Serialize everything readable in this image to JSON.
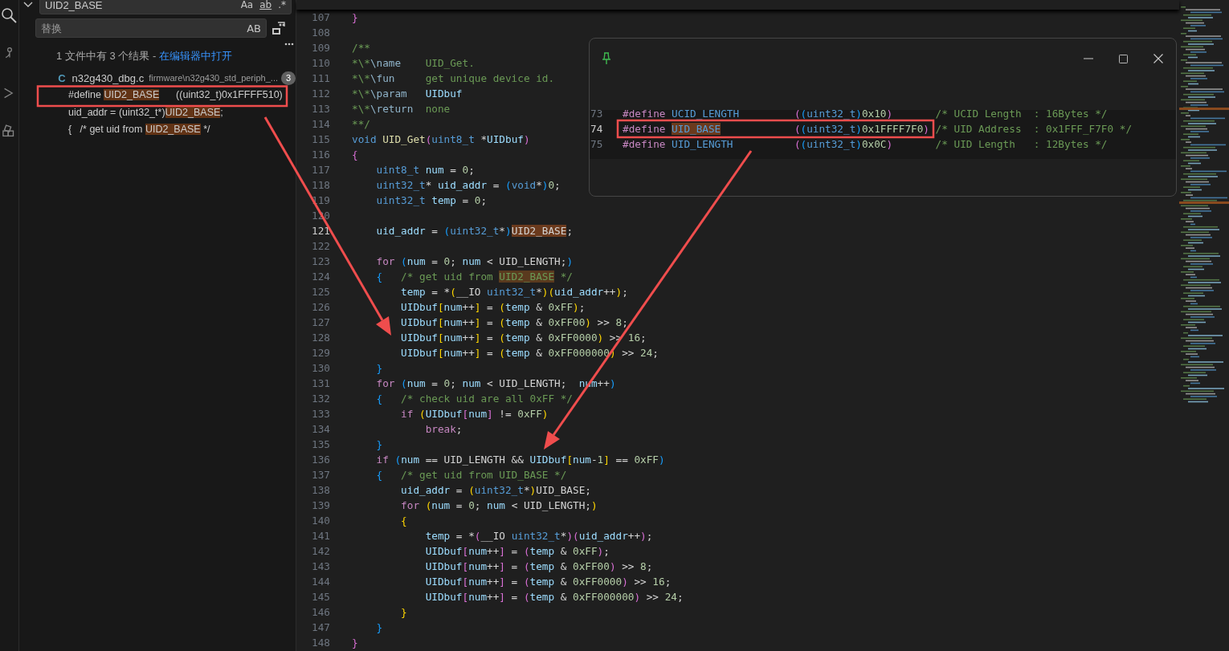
{
  "search": {
    "value": "UID2_BASE",
    "options": [
      "Aa",
      "ab",
      ".*"
    ],
    "replace_placeholder": "替换",
    "preserve_case": "AB"
  },
  "results": {
    "summary": "1 文件中有 3 个结果 - ",
    "open_link": "在编辑器中打开",
    "file": {
      "type_letter": "C",
      "name": "n32g430_dbg.c",
      "path": "firmware\\n32g430_std_periph_...",
      "count": "3"
    },
    "items": [
      {
        "before": "#define ",
        "match": "UID2_BASE",
        "after": "      ((uint32_t)0x1FFFF510)"
      },
      {
        "before": "uid_addr = (uint32_t*)",
        "match": "UID2_BASE",
        "after": ";"
      },
      {
        "before": "{   /* get uid from ",
        "match": "UID2_BASE",
        "after": " */"
      }
    ]
  },
  "editor": {
    "lines": [
      {
        "n": "107",
        "current": false,
        "tokens": [
          {
            "kind": "b2",
            "text": "}"
          }
        ]
      },
      {
        "n": "108",
        "current": false
      },
      {
        "n": "109",
        "current": false,
        "tokens": [
          {
            "kind": "comment",
            "text": "/**"
          }
        ]
      },
      {
        "n": "110",
        "current": false,
        "tokens": [
          {
            "kind": "comment",
            "text": "*\\*"
          },
          {
            "kind": "doctag",
            "text": "\\name"
          },
          {
            "kind": "comment",
            "text": "    UID_Get."
          }
        ]
      },
      {
        "n": "111",
        "current": false,
        "tokens": [
          {
            "kind": "comment",
            "text": "*\\*"
          },
          {
            "kind": "doctag",
            "text": "\\fun"
          },
          {
            "kind": "comment",
            "text": "     get unique device id."
          }
        ]
      },
      {
        "n": "112",
        "current": false,
        "tokens": [
          {
            "kind": "comment",
            "text": "*\\*"
          },
          {
            "kind": "doctag",
            "text": "\\param"
          },
          {
            "kind": "var",
            "text": "   UIDbuf"
          }
        ]
      },
      {
        "n": "113",
        "current": false,
        "tokens": [
          {
            "kind": "comment",
            "text": "*\\*"
          },
          {
            "kind": "doctag",
            "text": "\\return"
          },
          {
            "kind": "comment",
            "text": "  none"
          }
        ]
      },
      {
        "n": "114",
        "current": false,
        "tokens": [
          {
            "kind": "comment",
            "text": "**/"
          }
        ]
      },
      {
        "n": "115",
        "current": false,
        "tokens": [
          {
            "kind": "type",
            "text": "void"
          },
          {
            "kind": "func",
            "text": " UID_Get"
          },
          {
            "kind": "b2",
            "text": "("
          },
          {
            "kind": "type",
            "text": "uint8_t"
          },
          {
            "kind": "plain",
            "text": " *"
          },
          {
            "kind": "var",
            "text": "UIDbuf"
          },
          {
            "kind": "b2",
            "text": ")"
          }
        ]
      },
      {
        "n": "116",
        "current": false,
        "tokens": [
          {
            "kind": "b2",
            "text": "{"
          }
        ]
      },
      {
        "n": "117",
        "current": false,
        "tokens": [
          {
            "kind": "type",
            "text": "    uint8_t"
          },
          {
            "kind": "var",
            "text": " num"
          },
          {
            "kind": "plain",
            "text": " = "
          },
          {
            "kind": "num",
            "text": "0"
          },
          {
            "kind": "plain",
            "text": ";"
          }
        ]
      },
      {
        "n": "118",
        "current": false,
        "tokens": [
          {
            "kind": "type",
            "text": "    uint32_t"
          },
          {
            "kind": "plain",
            "text": "* "
          },
          {
            "kind": "var",
            "text": "uid_addr"
          },
          {
            "kind": "plain",
            "text": " = "
          },
          {
            "kind": "b3",
            "text": "("
          },
          {
            "kind": "type",
            "text": "void"
          },
          {
            "kind": "plain",
            "text": "*"
          },
          {
            "kind": "b3",
            "text": ")"
          },
          {
            "kind": "num",
            "text": "0"
          },
          {
            "kind": "plain",
            "text": ";"
          }
        ]
      },
      {
        "n": "119",
        "current": false,
        "tokens": [
          {
            "kind": "type",
            "text": "    uint32_t"
          },
          {
            "kind": "var",
            "text": " temp"
          },
          {
            "kind": "plain",
            "text": " = "
          },
          {
            "kind": "num",
            "text": "0"
          },
          {
            "kind": "plain",
            "text": ";"
          }
        ]
      },
      {
        "n": "120",
        "current": false
      },
      {
        "n": "121",
        "current": true,
        "tokens": [
          {
            "kind": "var",
            "text": "    uid_addr"
          },
          {
            "kind": "plain",
            "text": " = "
          },
          {
            "kind": "b3",
            "text": "("
          },
          {
            "kind": "type",
            "text": "uint32_t"
          },
          {
            "kind": "plain",
            "text": "*"
          },
          {
            "kind": "b3",
            "text": ")"
          },
          {
            "kind": "match",
            "text": "UID2_BASE"
          },
          {
            "kind": "plain",
            "text": ";"
          }
        ]
      },
      {
        "n": "122",
        "current": false
      },
      {
        "n": "123",
        "current": false,
        "tokens": [
          {
            "kind": "kw",
            "text": "    for"
          },
          {
            "kind": "b3",
            "text": " ("
          },
          {
            "kind": "var",
            "text": "num"
          },
          {
            "kind": "plain",
            "text": " = "
          },
          {
            "kind": "num",
            "text": "0"
          },
          {
            "kind": "plain",
            "text": "; "
          },
          {
            "kind": "var",
            "text": "num"
          },
          {
            "kind": "plain",
            "text": " < UID_LENGTH;"
          },
          {
            "kind": "b3",
            "text": ")"
          }
        ]
      },
      {
        "n": "124",
        "current": false,
        "tokens": [
          {
            "kind": "b3",
            "text": "    {"
          },
          {
            "kind": "comment",
            "text": "   /* get uid from "
          },
          {
            "kind": "cmatch",
            "text": "UID2_BASE"
          },
          {
            "kind": "comment",
            "text": " */"
          }
        ]
      },
      {
        "n": "125",
        "current": false,
        "tokens": [
          {
            "kind": "var",
            "text": "        temp"
          },
          {
            "kind": "plain",
            "text": " = *"
          },
          {
            "kind": "b1",
            "text": "("
          },
          {
            "kind": "plain",
            "text": "__IO "
          },
          {
            "kind": "type",
            "text": "uint32_t"
          },
          {
            "kind": "plain",
            "text": "*"
          },
          {
            "kind": "b1",
            "text": ")("
          },
          {
            "kind": "var",
            "text": "uid_addr"
          },
          {
            "kind": "plain",
            "text": "++"
          },
          {
            "kind": "b1",
            "text": ")"
          },
          {
            "kind": "plain",
            "text": ";"
          }
        ]
      },
      {
        "n": "126",
        "current": false,
        "tokens": [
          {
            "kind": "var",
            "text": "        UIDbuf"
          },
          {
            "kind": "b1",
            "text": "["
          },
          {
            "kind": "var",
            "text": "num"
          },
          {
            "kind": "plain",
            "text": "++"
          },
          {
            "kind": "b1",
            "text": "]"
          },
          {
            "kind": "plain",
            "text": " = "
          },
          {
            "kind": "b1",
            "text": "("
          },
          {
            "kind": "var",
            "text": "temp"
          },
          {
            "kind": "plain",
            "text": " & "
          },
          {
            "kind": "num",
            "text": "0xFF"
          },
          {
            "kind": "b1",
            "text": ")"
          },
          {
            "kind": "plain",
            "text": ";"
          }
        ]
      },
      {
        "n": "127",
        "current": false,
        "tokens": [
          {
            "kind": "var",
            "text": "        UIDbuf"
          },
          {
            "kind": "b1",
            "text": "["
          },
          {
            "kind": "var",
            "text": "num"
          },
          {
            "kind": "plain",
            "text": "++"
          },
          {
            "kind": "b1",
            "text": "]"
          },
          {
            "kind": "plain",
            "text": " = "
          },
          {
            "kind": "b1",
            "text": "("
          },
          {
            "kind": "var",
            "text": "temp"
          },
          {
            "kind": "plain",
            "text": " & "
          },
          {
            "kind": "num",
            "text": "0xFF00"
          },
          {
            "kind": "b1",
            "text": ")"
          },
          {
            "kind": "plain",
            "text": " >> "
          },
          {
            "kind": "num",
            "text": "8"
          },
          {
            "kind": "plain",
            "text": ";"
          }
        ]
      },
      {
        "n": "128",
        "current": false,
        "tokens": [
          {
            "kind": "var",
            "text": "        UIDbuf"
          },
          {
            "kind": "b1",
            "text": "["
          },
          {
            "kind": "var",
            "text": "num"
          },
          {
            "kind": "plain",
            "text": "++"
          },
          {
            "kind": "b1",
            "text": "]"
          },
          {
            "kind": "plain",
            "text": " = "
          },
          {
            "kind": "b1",
            "text": "("
          },
          {
            "kind": "var",
            "text": "temp"
          },
          {
            "kind": "plain",
            "text": " & "
          },
          {
            "kind": "num",
            "text": "0xFF0000"
          },
          {
            "kind": "b1",
            "text": ")"
          },
          {
            "kind": "plain",
            "text": " >> "
          },
          {
            "kind": "num",
            "text": "16"
          },
          {
            "kind": "plain",
            "text": ";"
          }
        ]
      },
      {
        "n": "129",
        "current": false,
        "tokens": [
          {
            "kind": "var",
            "text": "        UIDbuf"
          },
          {
            "kind": "b1",
            "text": "["
          },
          {
            "kind": "var",
            "text": "num"
          },
          {
            "kind": "plain",
            "text": "++"
          },
          {
            "kind": "b1",
            "text": "]"
          },
          {
            "kind": "plain",
            "text": " = "
          },
          {
            "kind": "b1",
            "text": "("
          },
          {
            "kind": "var",
            "text": "temp"
          },
          {
            "kind": "plain",
            "text": " & "
          },
          {
            "kind": "num",
            "text": "0xFF000000"
          },
          {
            "kind": "b1",
            "text": ")"
          },
          {
            "kind": "plain",
            "text": " >> "
          },
          {
            "kind": "num",
            "text": "24"
          },
          {
            "kind": "plain",
            "text": ";"
          }
        ]
      },
      {
        "n": "130",
        "current": false,
        "tokens": [
          {
            "kind": "b3",
            "text": "    }"
          }
        ]
      },
      {
        "n": "131",
        "current": false,
        "tokens": [
          {
            "kind": "kw",
            "text": "    for"
          },
          {
            "kind": "b3",
            "text": " ("
          },
          {
            "kind": "var",
            "text": "num"
          },
          {
            "kind": "plain",
            "text": " = "
          },
          {
            "kind": "num",
            "text": "0"
          },
          {
            "kind": "plain",
            "text": "; "
          },
          {
            "kind": "var",
            "text": "num"
          },
          {
            "kind": "plain",
            "text": " < UID_LENGTH;  "
          },
          {
            "kind": "var",
            "text": "num"
          },
          {
            "kind": "plain",
            "text": "++"
          },
          {
            "kind": "b3",
            "text": ")"
          }
        ]
      },
      {
        "n": "132",
        "current": false,
        "tokens": [
          {
            "kind": "b3",
            "text": "    {"
          },
          {
            "kind": "comment",
            "text": "   /* check uid are all 0xFF */"
          }
        ]
      },
      {
        "n": "133",
        "current": false,
        "tokens": [
          {
            "kind": "kw",
            "text": "        if"
          },
          {
            "kind": "b1",
            "text": " ("
          },
          {
            "kind": "var",
            "text": "UIDbuf"
          },
          {
            "kind": "b2",
            "text": "["
          },
          {
            "kind": "var",
            "text": "num"
          },
          {
            "kind": "b2",
            "text": "]"
          },
          {
            "kind": "plain",
            "text": " != "
          },
          {
            "kind": "num",
            "text": "0xFF"
          },
          {
            "kind": "b1",
            "text": ")"
          }
        ]
      },
      {
        "n": "134",
        "current": false,
        "tokens": [
          {
            "kind": "kw",
            "text": "            break"
          },
          {
            "kind": "plain",
            "text": ";"
          }
        ]
      },
      {
        "n": "135",
        "current": false,
        "tokens": [
          {
            "kind": "b3",
            "text": "    }"
          }
        ]
      },
      {
        "n": "136",
        "current": false,
        "tokens": [
          {
            "kind": "kw",
            "text": "    if"
          },
          {
            "kind": "b3",
            "text": " ("
          },
          {
            "kind": "var",
            "text": "num"
          },
          {
            "kind": "plain",
            "text": " == UID_LENGTH && "
          },
          {
            "kind": "var",
            "text": "UIDbuf"
          },
          {
            "kind": "b1",
            "text": "["
          },
          {
            "kind": "var",
            "text": "num"
          },
          {
            "kind": "plain",
            "text": "-"
          },
          {
            "kind": "num",
            "text": "1"
          },
          {
            "kind": "b1",
            "text": "]"
          },
          {
            "kind": "plain",
            "text": " == "
          },
          {
            "kind": "num",
            "text": "0xFF"
          },
          {
            "kind": "b3",
            "text": ")"
          }
        ]
      },
      {
        "n": "137",
        "current": false,
        "tokens": [
          {
            "kind": "b3",
            "text": "    {"
          },
          {
            "kind": "comment",
            "text": "   /* get uid from UID_BASE */"
          }
        ]
      },
      {
        "n": "138",
        "current": false,
        "tokens": [
          {
            "kind": "var",
            "text": "        uid_addr"
          },
          {
            "kind": "plain",
            "text": " = "
          },
          {
            "kind": "b1",
            "text": "("
          },
          {
            "kind": "type",
            "text": "uint32_t"
          },
          {
            "kind": "plain",
            "text": "*"
          },
          {
            "kind": "b1",
            "text": ")"
          },
          {
            "kind": "plain",
            "text": "UID_BASE;"
          }
        ]
      },
      {
        "n": "139",
        "current": false,
        "tokens": [
          {
            "kind": "kw",
            "text": "        for"
          },
          {
            "kind": "b1",
            "text": " ("
          },
          {
            "kind": "var",
            "text": "num"
          },
          {
            "kind": "plain",
            "text": " = "
          },
          {
            "kind": "num",
            "text": "0"
          },
          {
            "kind": "plain",
            "text": "; "
          },
          {
            "kind": "var",
            "text": "num"
          },
          {
            "kind": "plain",
            "text": " < UID_LENGTH;"
          },
          {
            "kind": "b1",
            "text": ")"
          }
        ]
      },
      {
        "n": "140",
        "current": false,
        "tokens": [
          {
            "kind": "b1",
            "text": "        {"
          }
        ]
      },
      {
        "n": "141",
        "current": false,
        "tokens": [
          {
            "kind": "var",
            "text": "            temp"
          },
          {
            "kind": "plain",
            "text": " = *"
          },
          {
            "kind": "b2",
            "text": "("
          },
          {
            "kind": "plain",
            "text": "__IO "
          },
          {
            "kind": "type",
            "text": "uint32_t"
          },
          {
            "kind": "plain",
            "text": "*"
          },
          {
            "kind": "b2",
            "text": ")("
          },
          {
            "kind": "var",
            "text": "uid_addr"
          },
          {
            "kind": "plain",
            "text": "++"
          },
          {
            "kind": "b2",
            "text": ")"
          },
          {
            "kind": "plain",
            "text": ";"
          }
        ]
      },
      {
        "n": "142",
        "current": false,
        "tokens": [
          {
            "kind": "var",
            "text": "            UIDbuf"
          },
          {
            "kind": "b2",
            "text": "["
          },
          {
            "kind": "var",
            "text": "num"
          },
          {
            "kind": "plain",
            "text": "++"
          },
          {
            "kind": "b2",
            "text": "]"
          },
          {
            "kind": "plain",
            "text": " = "
          },
          {
            "kind": "b2",
            "text": "("
          },
          {
            "kind": "var",
            "text": "temp"
          },
          {
            "kind": "plain",
            "text": " & "
          },
          {
            "kind": "num",
            "text": "0xFF"
          },
          {
            "kind": "b2",
            "text": ")"
          },
          {
            "kind": "plain",
            "text": ";"
          }
        ]
      },
      {
        "n": "143",
        "current": false,
        "tokens": [
          {
            "kind": "var",
            "text": "            UIDbuf"
          },
          {
            "kind": "b2",
            "text": "["
          },
          {
            "kind": "var",
            "text": "num"
          },
          {
            "kind": "plain",
            "text": "++"
          },
          {
            "kind": "b2",
            "text": "]"
          },
          {
            "kind": "plain",
            "text": " = "
          },
          {
            "kind": "b2",
            "text": "("
          },
          {
            "kind": "var",
            "text": "temp"
          },
          {
            "kind": "plain",
            "text": " & "
          },
          {
            "kind": "num",
            "text": "0xFF00"
          },
          {
            "kind": "b2",
            "text": ")"
          },
          {
            "kind": "plain",
            "text": " >> "
          },
          {
            "kind": "num",
            "text": "8"
          },
          {
            "kind": "plain",
            "text": ";"
          }
        ]
      },
      {
        "n": "144",
        "current": false,
        "tokens": [
          {
            "kind": "var",
            "text": "            UIDbuf"
          },
          {
            "kind": "b2",
            "text": "["
          },
          {
            "kind": "var",
            "text": "num"
          },
          {
            "kind": "plain",
            "text": "++"
          },
          {
            "kind": "b2",
            "text": "]"
          },
          {
            "kind": "plain",
            "text": " = "
          },
          {
            "kind": "b2",
            "text": "("
          },
          {
            "kind": "var",
            "text": "temp"
          },
          {
            "kind": "plain",
            "text": " & "
          },
          {
            "kind": "num",
            "text": "0xFF0000"
          },
          {
            "kind": "b2",
            "text": ")"
          },
          {
            "kind": "plain",
            "text": " >> "
          },
          {
            "kind": "num",
            "text": "16"
          },
          {
            "kind": "plain",
            "text": ";"
          }
        ]
      },
      {
        "n": "145",
        "current": false,
        "tokens": [
          {
            "kind": "var",
            "text": "            UIDbuf"
          },
          {
            "kind": "b2",
            "text": "["
          },
          {
            "kind": "var",
            "text": "num"
          },
          {
            "kind": "plain",
            "text": "++"
          },
          {
            "kind": "b2",
            "text": "]"
          },
          {
            "kind": "plain",
            "text": " = "
          },
          {
            "kind": "b2",
            "text": "("
          },
          {
            "kind": "var",
            "text": "temp"
          },
          {
            "kind": "plain",
            "text": " & "
          },
          {
            "kind": "num",
            "text": "0xFF000000"
          },
          {
            "kind": "b2",
            "text": ")"
          },
          {
            "kind": "plain",
            "text": " >> "
          },
          {
            "kind": "num",
            "text": "24"
          },
          {
            "kind": "plain",
            "text": ";"
          }
        ]
      },
      {
        "n": "146",
        "current": false,
        "tokens": [
          {
            "kind": "b1",
            "text": "        }"
          }
        ]
      },
      {
        "n": "147",
        "current": false,
        "tokens": [
          {
            "kind": "b3",
            "text": "    }"
          }
        ]
      },
      {
        "n": "148",
        "current": false,
        "tokens": [
          {
            "kind": "b2",
            "text": "}"
          }
        ]
      }
    ]
  },
  "peek": {
    "lines": [
      {
        "n": "73",
        "current": false,
        "tokens": [
          {
            "kind": "pre",
            "text": "#define "
          },
          {
            "kind": "macro",
            "text": "UCID_LENGTH"
          },
          {
            "kind": "b2",
            "text": "         ("
          },
          {
            "kind": "b3",
            "text": "("
          },
          {
            "kind": "type",
            "text": "uint32_t"
          },
          {
            "kind": "b3",
            "text": ")"
          },
          {
            "kind": "num",
            "text": "0x10"
          },
          {
            "kind": "b2",
            "text": ")"
          },
          {
            "kind": "comment",
            "text": "       /* UCID Length  : 16Bytes */"
          }
        ]
      },
      {
        "n": "74",
        "current": true,
        "tokens": [
          {
            "kind": "pre",
            "text": "#define "
          },
          {
            "kind": "mmatch",
            "text": "UID_BASE"
          },
          {
            "kind": "b2",
            "text": "            ("
          },
          {
            "kind": "b3",
            "text": "("
          },
          {
            "kind": "type",
            "text": "uint32_t"
          },
          {
            "kind": "b3",
            "text": ")"
          },
          {
            "kind": "num",
            "text": "0x1FFFF7F0"
          },
          {
            "kind": "b2",
            "text": ")"
          },
          {
            "kind": "comment",
            "text": " /* UID Address  : 0x1FFF_F7F0 */"
          }
        ]
      },
      {
        "n": "75",
        "current": false,
        "tokens": [
          {
            "kind": "pre",
            "text": "#define "
          },
          {
            "kind": "macro",
            "text": "UID_LENGTH"
          },
          {
            "kind": "b2",
            "text": "          ("
          },
          {
            "kind": "b3",
            "text": "("
          },
          {
            "kind": "type",
            "text": "uint32_t"
          },
          {
            "kind": "b3",
            "text": ")"
          },
          {
            "kind": "num",
            "text": "0x0C"
          },
          {
            "kind": "b2",
            "text": ")"
          },
          {
            "kind": "comment",
            "text": "       /* UID Length   : 12Bytes */"
          }
        ]
      }
    ]
  }
}
